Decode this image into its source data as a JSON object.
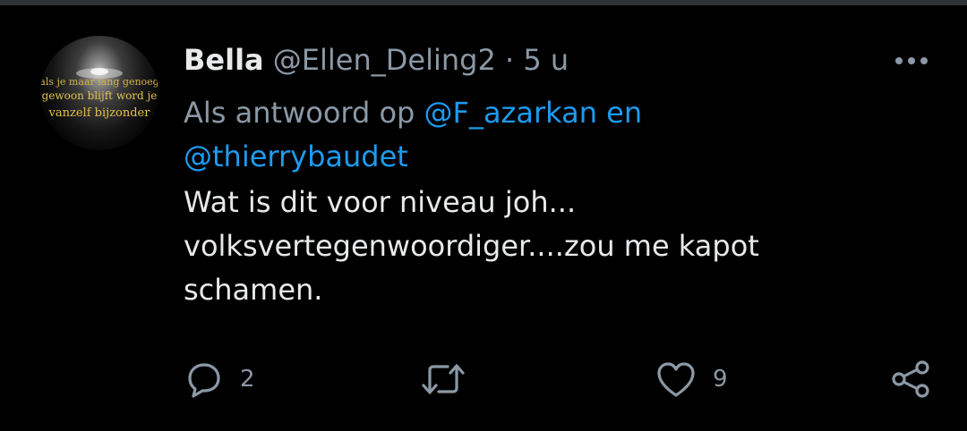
{
  "tweet": {
    "author_name": "Bella",
    "author_handle": "@Ellen_Deling2",
    "separator": "·",
    "time": "5 u",
    "reply_prefix": "Als antwoord op",
    "reply_mention_1": "@F_azarkan en",
    "reply_mention_2": "@thierrybaudet",
    "text_lines": [
      "Wat is dit voor niveau joh...",
      "volksvertegenwoordiger....zou me kapot",
      "schamen."
    ],
    "avatar_text": [
      "als je maar lang genoeg",
      "gewoon blijft word je",
      "vanzelf bijzonder"
    ]
  },
  "actions": {
    "reply_count": "2",
    "retweet_count": "",
    "like_count": "9"
  },
  "icons": {
    "more": "more-horizontal-icon",
    "reply": "reply-icon",
    "retweet": "retweet-icon",
    "like": "heart-icon",
    "share": "share-icon"
  },
  "colors": {
    "background": "#000000",
    "text_primary": "#e7e9ea",
    "text_secondary": "#8b98a5",
    "accent": "#1d9bf0"
  }
}
